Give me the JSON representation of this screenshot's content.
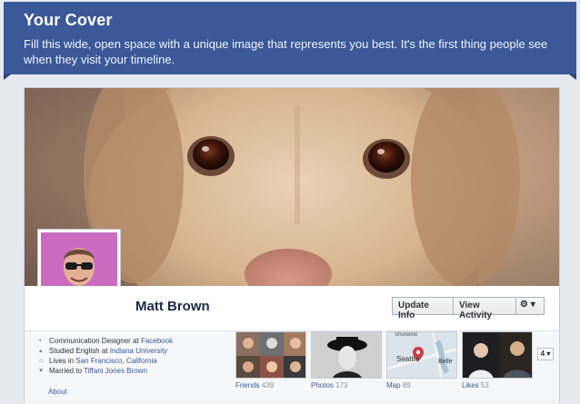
{
  "banner": {
    "title": "Your Cover",
    "text": "Fill this wide, open space with a unique image that represents you best. It's the first thing people see when they visit your timeline."
  },
  "profile": {
    "name": "Matt Brown",
    "update_info": "Update Info",
    "view_activity": "View Activity",
    "gear_caret": "⚙ ▾"
  },
  "about": {
    "items": [
      {
        "prefix": "Communication Designer at ",
        "link": "Facebook",
        "icon": "briefcase-icon"
      },
      {
        "prefix": "Studied English at ",
        "link": "Indiana University",
        "icon": "graduation-cap-icon"
      },
      {
        "prefix": "Lives in ",
        "link": "San Francisco, California",
        "icon": "home-icon"
      },
      {
        "prefix": "Married to ",
        "link": "Tiffani Jones Brown",
        "icon": "heart-icon"
      }
    ],
    "about_link": "About"
  },
  "tiles": {
    "friends": {
      "label": "Friends",
      "count": "439"
    },
    "photos": {
      "label": "Photos",
      "count": "173"
    },
    "map": {
      "label": "Map",
      "count": "89",
      "places": [
        "Shoreline",
        "Seattle",
        "Belle"
      ]
    },
    "likes": {
      "label": "Likes",
      "count": "53"
    },
    "more": "4 ▾"
  },
  "colors": {
    "brand_blue": "#3b5998",
    "banner_bg": "#3b5998",
    "link": "#3b5998"
  }
}
